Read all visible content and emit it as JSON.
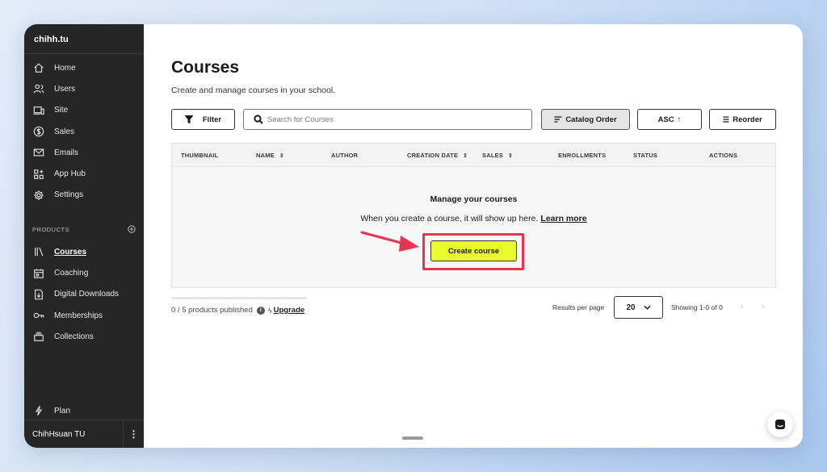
{
  "sidebar": {
    "school_name": "chihh.tu",
    "nav": [
      {
        "label": "Home",
        "icon": "home-icon"
      },
      {
        "label": "Users",
        "icon": "users-icon"
      },
      {
        "label": "Site",
        "icon": "site-icon"
      },
      {
        "label": "Sales",
        "icon": "dollar-icon"
      },
      {
        "label": "Emails",
        "icon": "mail-icon"
      },
      {
        "label": "App Hub",
        "icon": "app-hub-icon"
      },
      {
        "label": "Settings",
        "icon": "gear-icon"
      }
    ],
    "products_heading": "PRODUCTS",
    "products": [
      {
        "label": "Courses",
        "icon": "courses-icon",
        "active": true
      },
      {
        "label": "Coaching",
        "icon": "calendar-icon"
      },
      {
        "label": "Digital Downloads",
        "icon": "download-icon"
      },
      {
        "label": "Memberships",
        "icon": "key-icon"
      },
      {
        "label": "Collections",
        "icon": "collections-icon"
      }
    ],
    "plan_label": "Plan",
    "user_name": "ChihHsuan TU"
  },
  "main": {
    "title": "Courses",
    "subtitle": "Create and manage courses in your school.",
    "toolbar": {
      "filter_label": "Filter",
      "search_placeholder": "Search for Courses",
      "catalog_label": "Catalog Order",
      "asc_label": "ASC",
      "asc_arrow": "↑",
      "reorder_label": "Reorder"
    },
    "table": {
      "columns": [
        "THUMBNAIL",
        "NAME",
        "AUTHOR",
        "CREATION DATE",
        "SALES",
        "ENROLLMENTS",
        "STATUS",
        "ACTIONS"
      ],
      "sort_glyph": "⇕",
      "empty_title": "Manage your courses",
      "empty_text": "When you create a course, it will show up here.",
      "learn_more": "Learn more",
      "create_label": "Create course"
    },
    "footer": {
      "published": "0 / 5 products published",
      "published_fraction": 0.0,
      "info_glyph": "i",
      "upgrade": "Upgrade",
      "rpp_label": "Results per page",
      "rpp_value": "20",
      "showing": "Showing 1-0 of 0",
      "prev": "‹",
      "next": "›"
    }
  },
  "colors": {
    "sidebar_bg": "#262626",
    "create_button": "#e9fa2e",
    "highlight": "#e8344e"
  }
}
